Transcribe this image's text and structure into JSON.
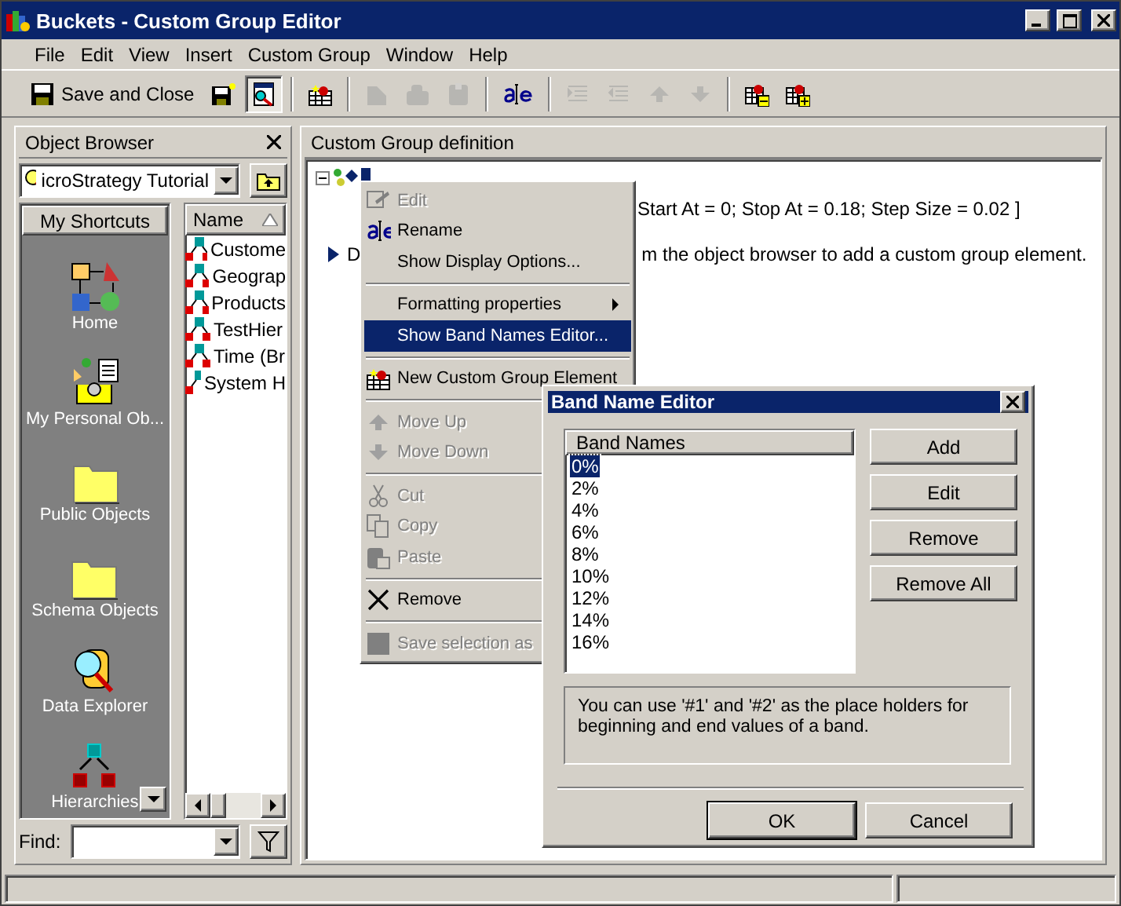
{
  "window": {
    "title": "Buckets - Custom Group Editor"
  },
  "menu_bar": [
    "File",
    "Edit",
    "View",
    "Insert",
    "Custom Group",
    "Window",
    "Help"
  ],
  "toolbar": {
    "save_label": "Save and Close",
    "buttons": [
      {
        "kind": "save-new",
        "disabled": false
      },
      {
        "kind": "browse",
        "disabled": false
      },
      {
        "kind": "new-element",
        "disabled": false
      },
      {
        "kind": "shape-a",
        "disabled": true
      },
      {
        "kind": "shape-b",
        "disabled": true
      },
      {
        "kind": "shape-c",
        "disabled": true
      },
      {
        "kind": "rename",
        "disabled": false
      },
      {
        "kind": "indent",
        "disabled": true
      },
      {
        "kind": "outdent",
        "disabled": true
      },
      {
        "kind": "up",
        "disabled": true
      },
      {
        "kind": "down",
        "disabled": true
      },
      {
        "kind": "grid-minus",
        "disabled": false
      },
      {
        "kind": "grid-plus",
        "disabled": false
      }
    ]
  },
  "object_browser": {
    "title": "Object Browser",
    "project": "icroStrategy Tutorial",
    "shortcuts_header": "My Shortcuts",
    "shortcuts": [
      {
        "label": "Home",
        "kind": "home"
      },
      {
        "label": "My Personal Ob...",
        "kind": "person"
      },
      {
        "label": "Public Objects",
        "kind": "folder"
      },
      {
        "label": "Schema Objects",
        "kind": "folder"
      },
      {
        "label": "Data Explorer",
        "kind": "explorer"
      },
      {
        "label": "Hierarchies",
        "kind": "hierarchy"
      }
    ],
    "column": "Name",
    "items": [
      "Custome",
      "Geograp",
      "Products",
      "TestHier",
      "Time (Br",
      "System H"
    ],
    "find_label": "Find:"
  },
  "definition": {
    "title": "Custom Group definition",
    "band_text": "Start At = 0; Stop At = 0.18; Step Size = 0.02 ]",
    "hint_start": "D",
    "hint_end": "m the object browser to add a custom group element."
  },
  "context_menu": [
    {
      "kind": "item",
      "label": "Edit",
      "disabled": true,
      "selected": false
    },
    {
      "kind": "item",
      "label": "Rename",
      "disabled": false,
      "selected": false
    },
    {
      "kind": "item",
      "label": "Show Display Options...",
      "disabled": false,
      "selected": false
    },
    {
      "kind": "separator"
    },
    {
      "kind": "submenu",
      "label": "Formatting properties",
      "disabled": false,
      "selected": false
    },
    {
      "kind": "item",
      "label": "Show Band Names Editor...",
      "disabled": false,
      "selected": true
    },
    {
      "kind": "separator"
    },
    {
      "kind": "item",
      "label": "New Custom Group Element",
      "disabled": false,
      "selected": false
    },
    {
      "kind": "separator"
    },
    {
      "kind": "item",
      "label": "Move Up",
      "disabled": true,
      "selected": false
    },
    {
      "kind": "item",
      "label": "Move Down",
      "disabled": true,
      "selected": false
    },
    {
      "kind": "separator"
    },
    {
      "kind": "item",
      "label": "Cut",
      "disabled": true,
      "selected": false
    },
    {
      "kind": "item",
      "label": "Copy",
      "disabled": true,
      "selected": false
    },
    {
      "kind": "item",
      "label": "Paste",
      "disabled": true,
      "selected": false
    },
    {
      "kind": "separator"
    },
    {
      "kind": "item",
      "label": "Remove",
      "disabled": false,
      "selected": false
    },
    {
      "kind": "separator"
    },
    {
      "kind": "item",
      "label": "Save selection as",
      "disabled": true,
      "selected": false
    }
  ],
  "dialog": {
    "title": "Band Name Editor",
    "column": "Band Names",
    "bands": [
      {
        "label": "0%",
        "selected": true
      },
      {
        "label": "2%",
        "selected": false
      },
      {
        "label": "4%",
        "selected": false
      },
      {
        "label": "6%",
        "selected": false
      },
      {
        "label": "8%",
        "selected": false
      },
      {
        "label": "10%",
        "selected": false
      },
      {
        "label": "12%",
        "selected": false
      },
      {
        "label": "14%",
        "selected": false
      },
      {
        "label": "16%",
        "selected": false
      }
    ],
    "buttons": [
      "Add",
      "Edit",
      "Remove",
      "Remove All"
    ],
    "hint": "You can use '#1' and '#2' as the place holders for beginning and end values of a band.",
    "footer_buttons": [
      {
        "label": "OK",
        "default": true
      },
      {
        "label": "Cancel",
        "default": false
      }
    ]
  }
}
